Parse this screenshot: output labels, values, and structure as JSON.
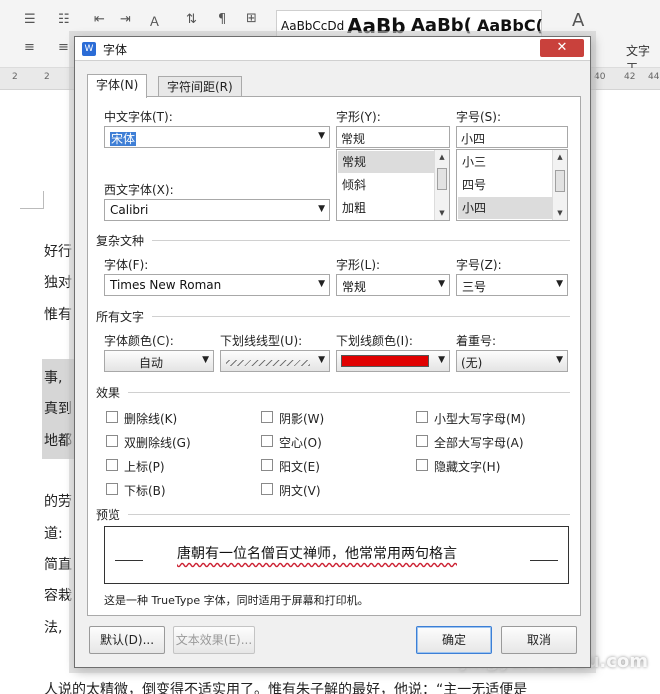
{
  "app": {
    "style_samples": [
      "AaBbCcDd",
      "AaBb",
      "AaBb(",
      "AaBbC("
    ],
    "ribbon_button": "文字工",
    "ruler_ticks": [
      "2",
      "2",
      "40",
      "42",
      "44"
    ],
    "doc_lines": [
      "好行",
      "独对",
      "惟有",
      "事,",
      "真到",
      "地都",
      "的劳",
      "道:",
      "简直",
      "容栽",
      "法,",
      "人说的太精微，倒变得不适实用了。惟有朱子解的最好，他说：“主一无适便是"
    ],
    "watermark": "jingyan.baidu.com"
  },
  "dialog": {
    "title": "字体",
    "app_icon": "W",
    "close_glyph": "✕",
    "tabs": [
      {
        "label": "字体(N)",
        "active": true
      },
      {
        "label": "字符间距(R)",
        "active": false
      }
    ],
    "cn_font": {
      "label": "中文字体(T):",
      "value": "宋体"
    },
    "west_font": {
      "label": "西文字体(X):",
      "value": "Calibri"
    },
    "style": {
      "label": "字形(Y):",
      "value": "常规",
      "options": [
        "常规",
        "倾斜",
        "加粗"
      ],
      "selected_index": 0
    },
    "size": {
      "label": "字号(S):",
      "value": "小四",
      "options": [
        "小三",
        "四号",
        "小四"
      ],
      "selected_index": 2
    },
    "complex": {
      "group_title": "复杂文种",
      "font": {
        "label": "字体(F):",
        "value": "Times New Roman"
      },
      "style": {
        "label": "字形(L):",
        "value": "常规"
      },
      "size": {
        "label": "字号(Z):",
        "value": "三号"
      }
    },
    "all_text": {
      "group_title": "所有文字",
      "font_color": {
        "label": "字体颜色(C):",
        "value": "自动"
      },
      "underline_type": {
        "label": "下划线线型(U):"
      },
      "underline_color": {
        "label": "下划线颜色(I):",
        "color": "#e00000"
      },
      "emphasis": {
        "label": "着重号:",
        "value": "(无)"
      }
    },
    "effects": {
      "group_title": "效果",
      "items": [
        "删除线(K)",
        "双删除线(G)",
        "上标(P)",
        "下标(B)",
        "阴影(W)",
        "空心(O)",
        "阳文(E)",
        "阴文(V)",
        "小型大写字母(M)",
        "全部大写字母(A)",
        "隐藏文字(H)"
      ]
    },
    "preview": {
      "group_title": "预览",
      "sample_text": "唐朝有一位名僧百丈禅师，他常常用两句格言",
      "note": "这是一种 TrueType 字体，同时适用于屏幕和打印机。"
    },
    "buttons": {
      "default": "默认(D)...",
      "text_effects": "文本效果(E)...",
      "ok": "确定",
      "cancel": "取消"
    }
  }
}
